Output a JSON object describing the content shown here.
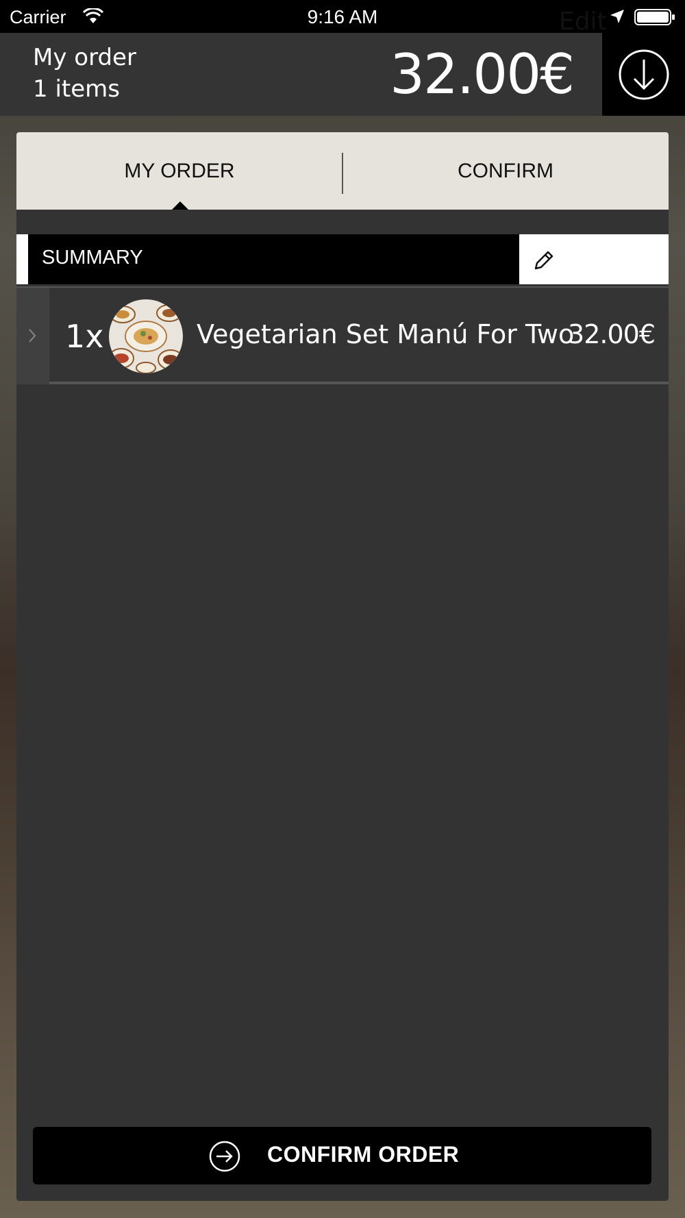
{
  "status_bar": {
    "carrier": "Carrier",
    "time": "9:16 AM"
  },
  "header": {
    "title": "My order",
    "item_count": "1 items",
    "total": "32.00€",
    "download_icon": "arrow-down-circle-icon"
  },
  "tabs": [
    {
      "label": "MY ORDER",
      "active": true
    },
    {
      "label": "CONFIRM",
      "active": false
    }
  ],
  "summary": {
    "label": "SUMMARY",
    "edit_label": "Edit",
    "edit_icon": "pencil-icon"
  },
  "order_items": [
    {
      "quantity": "1x",
      "name": "Vegetarian Set Manú For Two",
      "price": "32.00€",
      "thumbnail": "food-dish-photo"
    }
  ],
  "actions": {
    "confirm_order_label": "CONFIRM ORDER",
    "confirm_icon": "arrow-right-circle-icon"
  },
  "colors": {
    "header_bg": "#343434",
    "panel_bg": "#333333",
    "tabs_bg": "#e6e3dc",
    "accent": "#000000"
  }
}
